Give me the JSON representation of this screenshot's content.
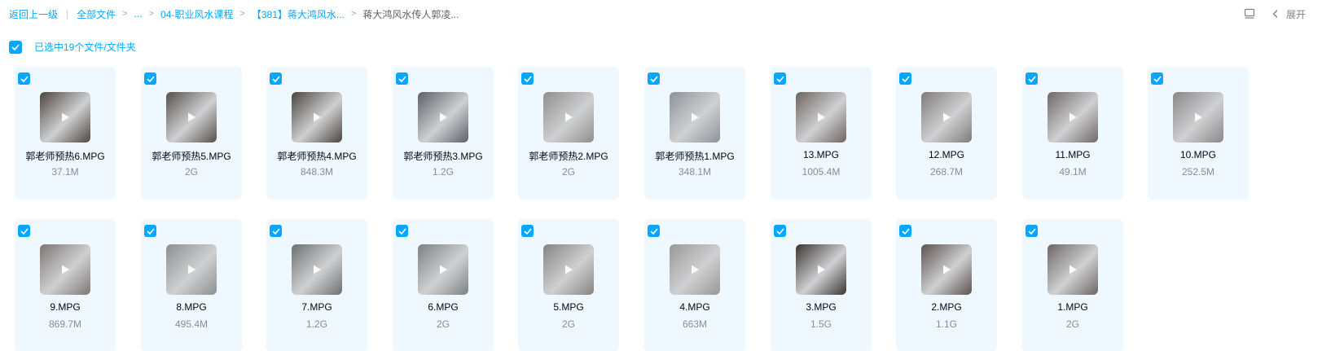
{
  "breadcrumb": {
    "back": "返回上一级",
    "all_files": "全部文件",
    "ellipsis": "...",
    "folder1": "04-职业风水课程",
    "folder2": "【381】蒋大鸿风水...",
    "current": "蒋大鸿风水传人郭凌..."
  },
  "toolbar": {
    "expand_label": "展开"
  },
  "selection": {
    "label": "已选中19个文件/文件夹"
  },
  "colors": {
    "accent": "#06a7ff",
    "card_bg": "#eef8fe"
  },
  "files": [
    {
      "name": "郭老师预热6.MPG",
      "size": "37.1M",
      "thumb": "#4d4640"
    },
    {
      "name": "郭老师预热5.MPG",
      "size": "2G",
      "thumb": "#55504a"
    },
    {
      "name": "郭老师预热4.MPG",
      "size": "848.3M",
      "thumb": "#4a443e"
    },
    {
      "name": "郭老师预热3.MPG",
      "size": "1.2G",
      "thumb": "#5d6068"
    },
    {
      "name": "郭老师预热2.MPG",
      "size": "2G",
      "thumb": "#8f8e8c"
    },
    {
      "name": "郭老师预热1.MPG",
      "size": "348.1M",
      "thumb": "#8d9298"
    },
    {
      "name": "13.MPG",
      "size": "1005.4M",
      "thumb": "#6e6460"
    },
    {
      "name": "12.MPG",
      "size": "268.7M",
      "thumb": "#7f7a7a"
    },
    {
      "name": "11.MPG",
      "size": "49.1M",
      "thumb": "#6f6766"
    },
    {
      "name": "10.MPG",
      "size": "252.5M",
      "thumb": "#8a8788"
    },
    {
      "name": "9.MPG",
      "size": "869.7M",
      "thumb": "#7d7673"
    },
    {
      "name": "8.MPG",
      "size": "495.4M",
      "thumb": "#8d8f90"
    },
    {
      "name": "7.MPG",
      "size": "1.2G",
      "thumb": "#6c6f70"
    },
    {
      "name": "6.MPG",
      "size": "2G",
      "thumb": "#7d8182"
    },
    {
      "name": "5.MPG",
      "size": "2G",
      "thumb": "#858381"
    },
    {
      "name": "4.MPG",
      "size": "663M",
      "thumb": "#9a9896"
    },
    {
      "name": "3.MPG",
      "size": "1.5G",
      "thumb": "#3a3532"
    },
    {
      "name": "2.MPG",
      "size": "1.1G",
      "thumb": "#5b524f"
    },
    {
      "name": "1.MPG",
      "size": "2G",
      "thumb": "#6c6665"
    }
  ]
}
